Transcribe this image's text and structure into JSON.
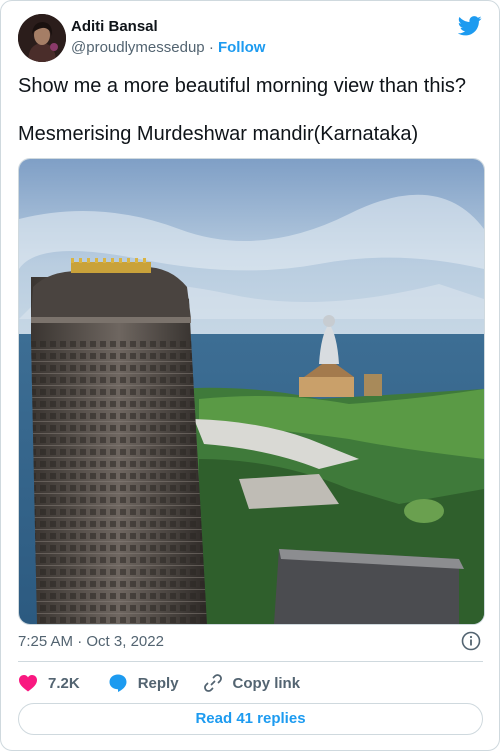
{
  "author": {
    "name": "Aditi Bansal",
    "handle": "@proudlymessedup",
    "separator": "·",
    "follow_label": "Follow"
  },
  "tweet": {
    "line1": "Show me a more beautiful morning view than this?",
    "line2": "Mesmerising Murdeshwar mandir(Karnataka)"
  },
  "meta": {
    "time": "7:25 AM",
    "separator": "·",
    "date": "Oct 3, 2022"
  },
  "actions": {
    "likes_count": "7.2K",
    "reply_label": "Reply",
    "copy_label": "Copy link"
  },
  "read_replies_label": "Read 41 replies",
  "colors": {
    "accent": "#1d9bf0",
    "like": "#f91880",
    "muted": "#536471",
    "border": "#cfd9de"
  },
  "icons": [
    "twitter-bird-icon",
    "info-icon",
    "heart-icon",
    "reply-bubble-icon",
    "link-icon"
  ]
}
